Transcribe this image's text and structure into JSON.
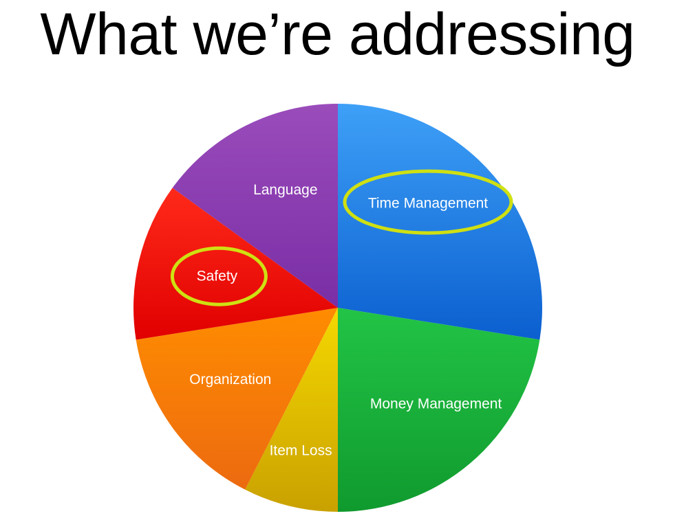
{
  "slide": {
    "title": "What we’re addressing"
  },
  "chart_data": {
    "type": "pie",
    "title": "",
    "slices": [
      {
        "label": "Time Management",
        "value": 27.5,
        "color": "#1a86e8",
        "color_light": "#3ea0f7",
        "color_dark": "#0b5fcf",
        "highlighted": true
      },
      {
        "label": "Money Management",
        "value": 22.5,
        "color": "#16b43a",
        "color_light": "#22c446",
        "color_dark": "#109a2e",
        "highlighted": false
      },
      {
        "label": "Item Loss",
        "value": 7.5,
        "color": "#e2bd00",
        "color_light": "#f5d800",
        "color_dark": "#c9a100",
        "highlighted": false
      },
      {
        "label": "Organization",
        "value": 15,
        "color": "#f27a0a",
        "color_light": "#ff8c00",
        "color_dark": "#ec6a10",
        "highlighted": false
      },
      {
        "label": "Safety",
        "value": 12.5,
        "color": "#ee0a0a",
        "color_light": "#ff2a1a",
        "color_dark": "#e00000",
        "highlighted": true
      },
      {
        "label": "Language",
        "value": 15,
        "color": "#8a3fb0",
        "color_light": "#9a4cbb",
        "color_dark": "#7a2ea5",
        "highlighted": false
      }
    ],
    "start_angle_deg": 0,
    "direction": "clockwise",
    "legend": "none",
    "highlight_color": "#cfe012"
  }
}
